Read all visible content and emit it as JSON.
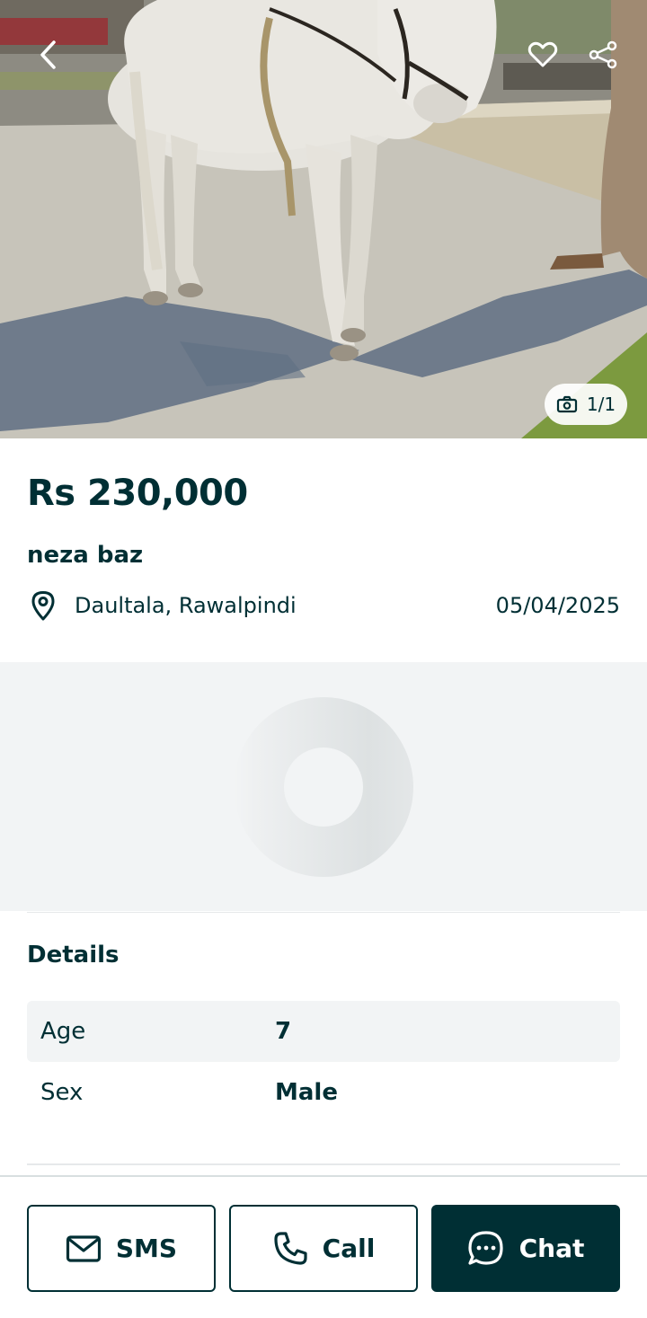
{
  "colors": {
    "primary": "#002f34",
    "surface_grey": "#f2f4f5",
    "white": "#ffffff"
  },
  "gallery": {
    "counter": "1/1",
    "icons": {
      "back": "chevron-left-icon",
      "favorite": "heart-icon",
      "share": "share-icon",
      "counter": "camera-icon"
    }
  },
  "listing": {
    "price": "Rs 230,000",
    "title": "neza baz",
    "location": "Daultala, Rawalpindi",
    "date": "05/04/2025"
  },
  "details": {
    "heading": "Details",
    "rows": [
      {
        "key": "Age",
        "value": "7"
      },
      {
        "key": "Sex",
        "value": "Male"
      }
    ]
  },
  "actions": {
    "sms_label": "SMS",
    "call_label": "Call",
    "chat_label": "Chat"
  }
}
